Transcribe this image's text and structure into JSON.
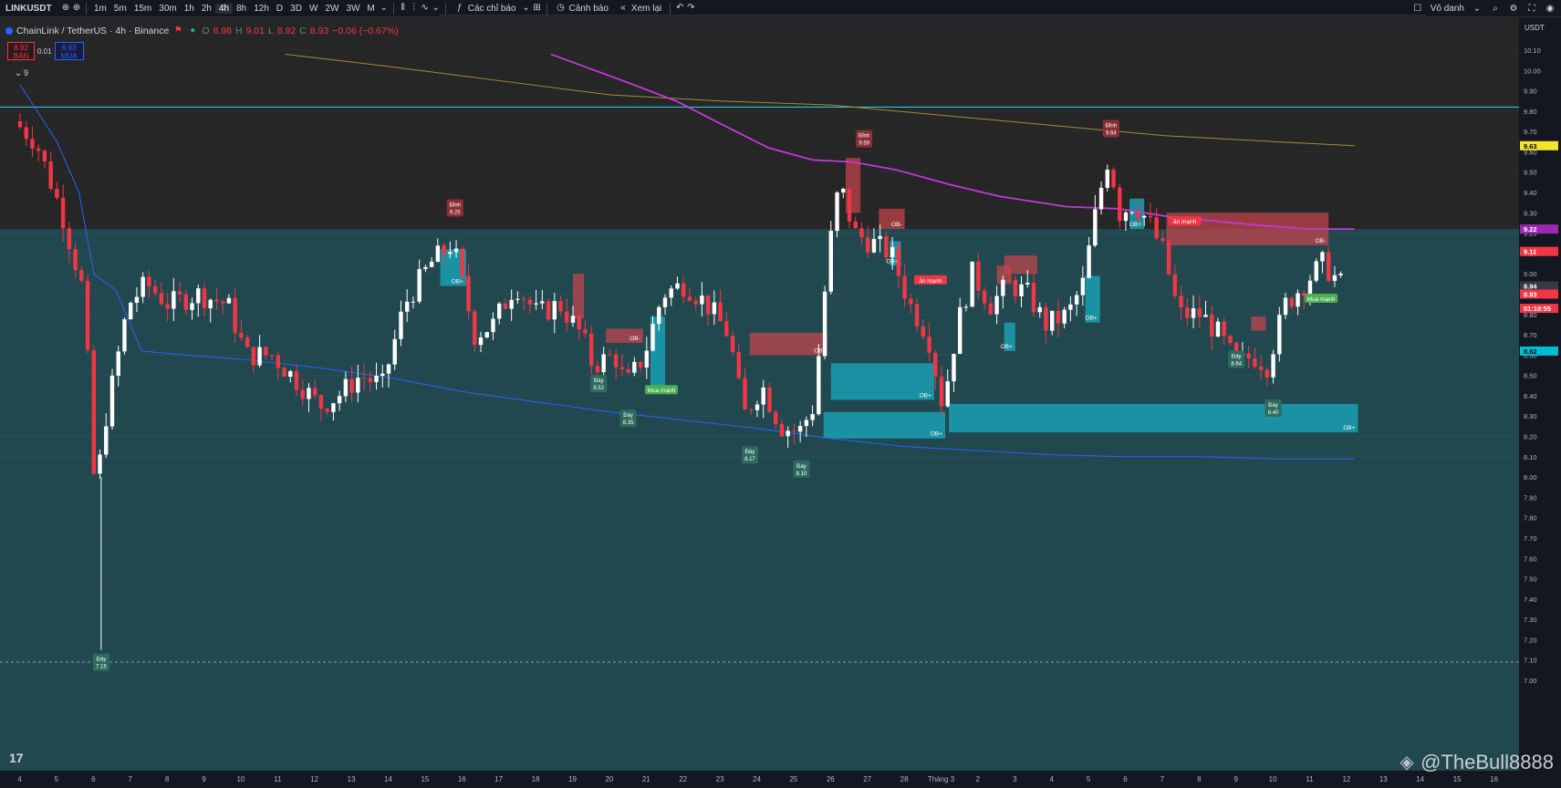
{
  "header": {
    "symbol": "LINKUSDT",
    "timeframes": [
      "1m",
      "5m",
      "15m",
      "30m",
      "1h",
      "2h",
      "4h",
      "8h",
      "12h",
      "D",
      "3D",
      "W",
      "2W",
      "3W",
      "M"
    ],
    "active_timeframe": "4h",
    "indicators_label": "Các chỉ báo",
    "alert_label": "Cảnh báo",
    "replay_label": "Xem lại",
    "account_label": "Vô danh"
  },
  "legend": {
    "title": "ChainLink / TetherUS · 4h · Binance",
    "o_label": "O",
    "o_value": "8.98",
    "h_label": "H",
    "h_value": "9.01",
    "l_label": "L",
    "l_value": "8.92",
    "c_label": "C",
    "c_value": "8.93",
    "change": "−0.06 (−0.67%)"
  },
  "trade": {
    "sell_price": "8.92",
    "sell_label": "BÁN",
    "spread": "0.01",
    "buy_price": "8.93",
    "buy_label": "MUA"
  },
  "indicator_count": "9",
  "price_axis": {
    "currency": "USDT",
    "ticks": [
      "10.10",
      "10.00",
      "9.90",
      "9.80",
      "9.70",
      "9.60",
      "9.50",
      "9.40",
      "9.30",
      "9.20",
      "9.10",
      "9.00",
      "8.90",
      "8.80",
      "8.70",
      "8.60",
      "8.50",
      "8.40",
      "8.30",
      "8.20",
      "8.10",
      "8.00",
      "7.90",
      "7.80",
      "7.70",
      "7.60",
      "7.50",
      "7.40",
      "7.30",
      "7.20",
      "7.10",
      "7.00"
    ],
    "badges": [
      {
        "price": 9.63,
        "text": "9.63",
        "color": "#f5e52a",
        "textColor": "#000"
      },
      {
        "price": 9.22,
        "text": "9.22",
        "color": "#9c27b0",
        "textColor": "#fff"
      },
      {
        "price": 9.11,
        "text": "9.11",
        "color": "#f23645",
        "textColor": "#fff"
      },
      {
        "price": 8.94,
        "text": "8.94",
        "color": "#363a45",
        "textColor": "#fff"
      },
      {
        "price": 8.9,
        "text": "8.93",
        "color": "#f23645",
        "textColor": "#fff"
      },
      {
        "price": 8.83,
        "text": "01:19:55",
        "color": "#f23645",
        "textColor": "#fff"
      },
      {
        "price": 8.62,
        "text": "8.62",
        "color": "#00bcd4",
        "textColor": "#000"
      }
    ]
  },
  "time_axis": [
    "4",
    "5",
    "6",
    "7",
    "8",
    "9",
    "10",
    "11",
    "12",
    "13",
    "14",
    "15",
    "16",
    "17",
    "18",
    "19",
    "20",
    "21",
    "22",
    "23",
    "24",
    "25",
    "26",
    "27",
    "28",
    "Tháng 3",
    "2",
    "3",
    "4",
    "5",
    "6",
    "7",
    "8",
    "9",
    "10",
    "11",
    "12",
    "13",
    "14",
    "15",
    "16"
  ],
  "chart_data": {
    "type": "candlestick",
    "symbol": "LINKUSDT",
    "ylim": [
      7.0,
      10.1
    ],
    "zone_split_price": 9.22,
    "hline_price": 9.82,
    "labels": [
      {
        "kind": "peak",
        "t": 11.8,
        "p": 9.25,
        "line1": "Đỉnh",
        "line2": "9.25"
      },
      {
        "kind": "peak",
        "t": 22.9,
        "p": 9.59,
        "line1": "Đỉnh",
        "line2": "9.59"
      },
      {
        "kind": "peak",
        "t": 29.6,
        "p": 9.64,
        "line1": "Đỉnh",
        "line2": "9.64"
      },
      {
        "kind": "bottom",
        "t": 2.2,
        "p": 7.15,
        "line1": "Đáy",
        "line2": "7.15"
      },
      {
        "kind": "bottom",
        "t": 15.7,
        "p": 8.52,
        "line1": "Đáy",
        "line2": "8.52"
      },
      {
        "kind": "bottom",
        "t": 16.5,
        "p": 8.35,
        "line1": "Đáy",
        "line2": "8.35"
      },
      {
        "kind": "bottom",
        "t": 19.8,
        "p": 8.17,
        "line1": "Đáy",
        "line2": "8.17"
      },
      {
        "kind": "bottom",
        "t": 21.2,
        "p": 8.1,
        "line1": "Đáy",
        "line2": "8.10"
      },
      {
        "kind": "bottom",
        "t": 33.0,
        "p": 8.64,
        "line1": "Đáy",
        "line2": "8.64"
      },
      {
        "kind": "bottom",
        "t": 34.0,
        "p": 8.4,
        "line1": "Đáy",
        "line2": "8.40"
      }
    ],
    "zones": [
      {
        "type": "bull",
        "t0": 11.4,
        "t1": 12.1,
        "p0": 8.94,
        "p1": 9.12,
        "label": "OB+"
      },
      {
        "type": "bull",
        "t0": 17.1,
        "t1": 17.5,
        "p0": 8.45,
        "p1": 8.79,
        "label": ""
      },
      {
        "type": "bull",
        "t0": 22.0,
        "t1": 24.8,
        "p0": 8.38,
        "p1": 8.56,
        "label": "OB+"
      },
      {
        "type": "bull",
        "t0": 21.8,
        "t1": 25.1,
        "p0": 8.19,
        "p1": 8.32,
        "label": "OB+"
      },
      {
        "type": "bull",
        "t0": 25.2,
        "t1": 36.3,
        "p0": 8.22,
        "p1": 8.36,
        "label": "OB+"
      },
      {
        "type": "bull",
        "t0": 23.6,
        "t1": 23.9,
        "p0": 9.04,
        "p1": 9.16,
        "label": "OB+"
      },
      {
        "type": "bull",
        "t0": 26.7,
        "t1": 27.0,
        "p0": 8.62,
        "p1": 8.76,
        "label": "OB+"
      },
      {
        "type": "bull",
        "t0": 28.9,
        "t1": 29.3,
        "p0": 8.76,
        "p1": 8.99,
        "label": "OB+"
      },
      {
        "type": "bull",
        "t0": 30.1,
        "t1": 30.5,
        "p0": 9.22,
        "p1": 9.37,
        "label": "OB+"
      },
      {
        "type": "bear",
        "t0": 15.0,
        "t1": 15.3,
        "p0": 8.78,
        "p1": 9.0,
        "label": ""
      },
      {
        "type": "bear",
        "t0": 15.9,
        "t1": 16.9,
        "p0": 8.66,
        "p1": 8.73,
        "label": "OB-"
      },
      {
        "type": "bear",
        "t0": 19.8,
        "t1": 21.9,
        "p0": 8.6,
        "p1": 8.71,
        "label": "OB-"
      },
      {
        "type": "bear",
        "t0": 22.4,
        "t1": 22.8,
        "p0": 9.3,
        "p1": 9.57,
        "label": ""
      },
      {
        "type": "bear",
        "t0": 23.3,
        "t1": 24.0,
        "p0": 9.22,
        "p1": 9.32,
        "label": "OB-"
      },
      {
        "type": "bear",
        "t0": 26.5,
        "t1": 26.9,
        "p0": 8.95,
        "p1": 9.04,
        "label": ""
      },
      {
        "type": "bear",
        "t0": 26.7,
        "t1": 27.6,
        "p0": 9.0,
        "p1": 9.09,
        "label": ""
      },
      {
        "type": "bear",
        "t0": 31.1,
        "t1": 35.5,
        "p0": 9.14,
        "p1": 9.3,
        "label": "OB-"
      },
      {
        "type": "bear",
        "t0": 33.4,
        "t1": 33.8,
        "p0": 8.72,
        "p1": 8.79,
        "label": ""
      }
    ],
    "tags": [
      {
        "t": 17.4,
        "p": 8.43,
        "text": "Mua mạnh",
        "color": "#4caf50"
      },
      {
        "t": 24.7,
        "p": 8.97,
        "text": "ăn mạnh",
        "color": "#f23645"
      },
      {
        "t": 31.6,
        "p": 9.26,
        "text": "ăn mạnh",
        "color": "#f23645"
      },
      {
        "t": 35.3,
        "p": 8.88,
        "text": "Mua mạnh",
        "color": "#4caf50"
      }
    ],
    "ma_purple": [
      [
        14.4,
        10.08
      ],
      [
        16.5,
        9.94
      ],
      [
        17.8,
        9.85
      ],
      [
        19.2,
        9.72
      ],
      [
        20.3,
        9.62
      ],
      [
        21.5,
        9.56
      ],
      [
        22.6,
        9.55
      ],
      [
        23.8,
        9.51
      ],
      [
        25.2,
        9.44
      ],
      [
        26.6,
        9.38
      ],
      [
        28.4,
        9.33
      ],
      [
        29.8,
        9.32
      ],
      [
        31.2,
        9.28
      ],
      [
        32.4,
        9.26
      ],
      [
        33.5,
        9.24
      ],
      [
        35.0,
        9.22
      ],
      [
        36.2,
        9.22
      ]
    ],
    "ma_gold": [
      [
        7.2,
        10.08
      ],
      [
        10.0,
        10.02
      ],
      [
        13.0,
        9.95
      ],
      [
        16.0,
        9.88
      ],
      [
        19.0,
        9.85
      ],
      [
        22.0,
        9.83
      ],
      [
        25.0,
        9.78
      ],
      [
        28.0,
        9.73
      ],
      [
        31.0,
        9.68
      ],
      [
        34.0,
        9.65
      ],
      [
        36.2,
        9.63
      ]
    ],
    "ma_blue": [
      [
        0,
        9.93
      ],
      [
        1.0,
        9.65
      ],
      [
        1.6,
        9.4
      ],
      [
        2.0,
        9.0
      ],
      [
        2.6,
        8.92
      ],
      [
        3.3,
        8.62
      ],
      [
        4.5,
        8.6
      ],
      [
        6.0,
        8.58
      ],
      [
        8.0,
        8.54
      ],
      [
        10.0,
        8.49
      ],
      [
        12.0,
        8.42
      ],
      [
        14.0,
        8.37
      ],
      [
        16.0,
        8.32
      ],
      [
        18.0,
        8.28
      ],
      [
        20.0,
        8.24
      ],
      [
        22.0,
        8.19
      ],
      [
        24.0,
        8.15
      ],
      [
        26.0,
        8.13
      ],
      [
        28.0,
        8.11
      ],
      [
        30.0,
        8.1
      ],
      [
        32.0,
        8.1
      ],
      [
        34.0,
        8.09
      ],
      [
        36.2,
        8.09
      ]
    ]
  },
  "watermark": "@TheBull8888",
  "tv_logo": "17"
}
